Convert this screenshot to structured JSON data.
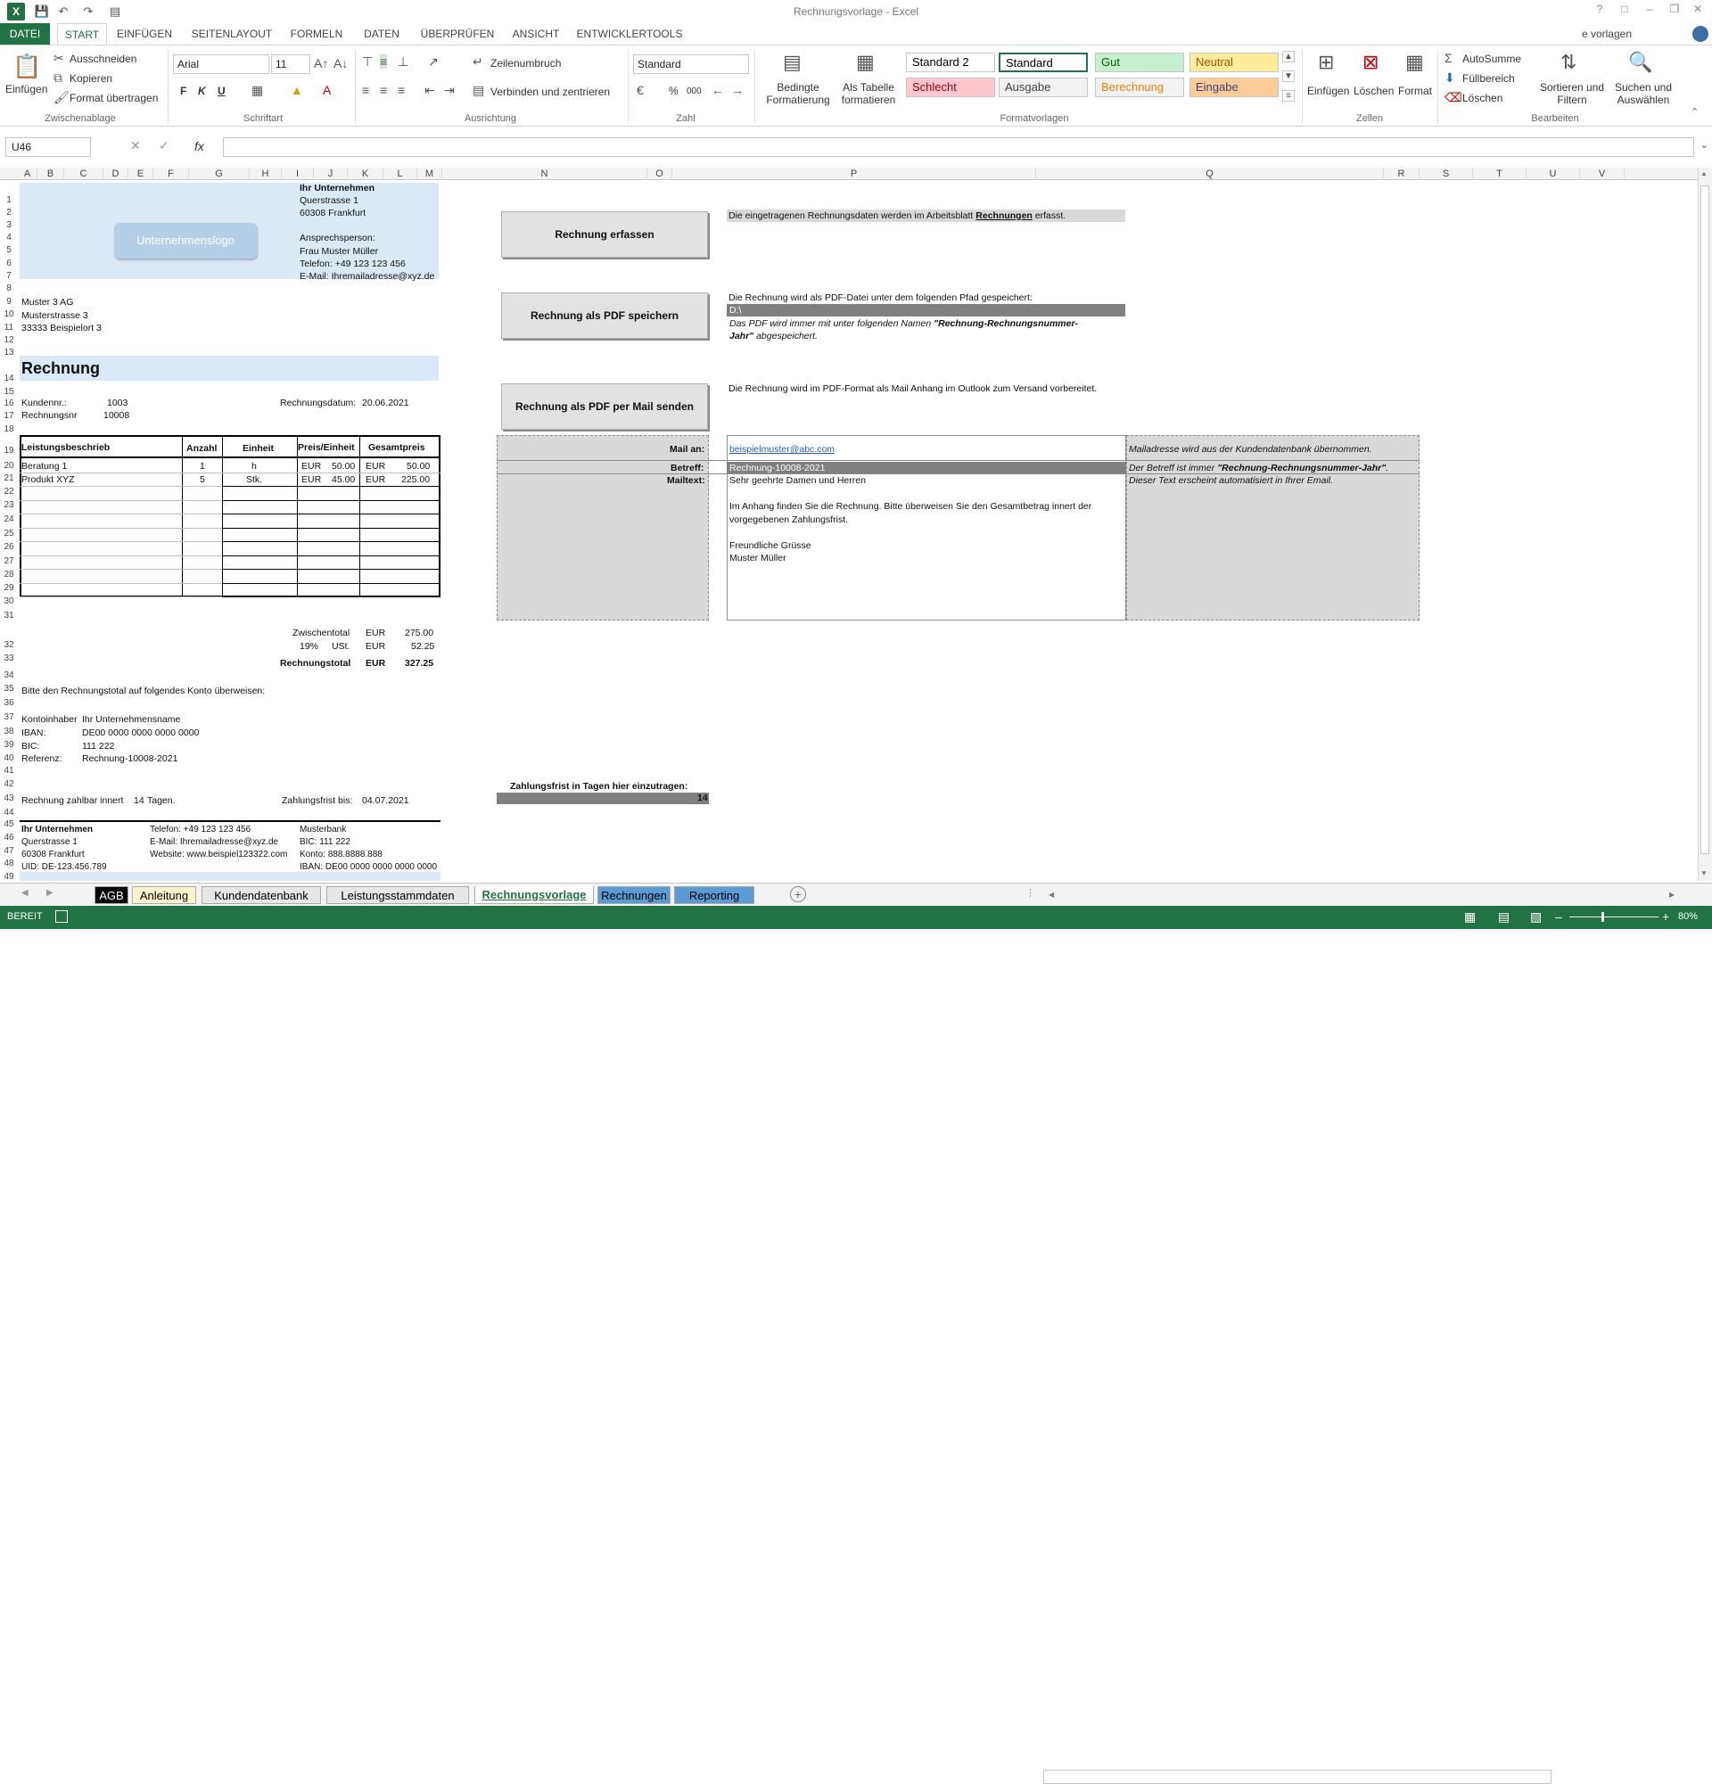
{
  "window": {
    "title": "Rechnungsvorlage - Excel",
    "app_logo": "X"
  },
  "ribbon_tabs": [
    "DATEI",
    "START",
    "EINFÜGEN",
    "SEITENLAYOUT",
    "FORMELN",
    "DATEN",
    "ÜBERPRÜFEN",
    "ANSICHT",
    "ENTWICKLERTOOLS"
  ],
  "user": "e vorlagen",
  "ribbon": {
    "clipboard": {
      "label": "Zwischenablage",
      "paste": "Einfügen",
      "cut": "Ausschneiden",
      "copy": "Kopieren",
      "format_painter": "Format übertragen"
    },
    "font": {
      "label": "Schriftart",
      "name": "Arial",
      "size": "11",
      "bold": "F",
      "italic": "K",
      "underline": "U"
    },
    "alignment": {
      "label": "Ausrichtung",
      "wrap": "Zeilenumbruch",
      "merge": "Verbinden und zentrieren"
    },
    "number": {
      "label": "Zahl",
      "format": "Standard",
      "percent": "%",
      "thousands": "000"
    },
    "styles": {
      "label": "Formatvorlagen",
      "cond_fmt": "Bedingte Formatierung",
      "as_table": "Als Tabelle formatieren",
      "cells": [
        {
          "name": "Standard 2",
          "bg": "#ffffff",
          "fg": "#000000"
        },
        {
          "name": "Standard",
          "bg": "#ffffff",
          "fg": "#000000"
        },
        {
          "name": "Gut",
          "bg": "#c6efce",
          "fg": "#006100"
        },
        {
          "name": "Neutral",
          "bg": "#ffeb9c",
          "fg": "#9c5700"
        },
        {
          "name": "Schlecht",
          "bg": "#ffc7ce",
          "fg": "#9c0006"
        },
        {
          "name": "Ausgabe",
          "bg": "#f2f2f2",
          "fg": "#3f3f3f"
        },
        {
          "name": "Berechnung",
          "bg": "#f2f2f2",
          "fg": "#fa7d00"
        },
        {
          "name": "Eingabe",
          "bg": "#ffcc99",
          "fg": "#3f3f76"
        }
      ]
    },
    "cells_grp": {
      "label": "Zellen",
      "insert": "Einfügen",
      "delete": "Löschen",
      "format": "Format"
    },
    "editing": {
      "label": "Bearbeiten",
      "autosum": "AutoSumme",
      "fill": "Füllbereich",
      "clear": "Löschen",
      "sort": "Sortieren und Filtern",
      "find": "Suchen und Auswählen"
    }
  },
  "formula_bar": {
    "name_box": "U46",
    "fx": "fx",
    "content": ""
  },
  "columns": [
    "A",
    "B",
    "C",
    "D",
    "E",
    "F",
    "G",
    "H",
    "I",
    "J",
    "K",
    "L",
    "M",
    "N",
    "O",
    "P",
    "Q",
    "R",
    "S",
    "T",
    "U",
    "V"
  ],
  "invoice": {
    "logo_text": "Unternehmenslogo",
    "company": [
      "Ihr Unternehmen",
      "Querstrasse 1",
      "60308 Frankfurt",
      "",
      "Ansprechsperson:",
      "Frau Muster Müller",
      "Telefon: +49 123 123 456",
      "E-Mail: Ihremailadresse@xyz.de"
    ],
    "recipient": [
      "Muster 3 AG",
      "Musterstrasse 3",
      "33333  Beispielort 3"
    ],
    "title": "Rechnung",
    "customer_no_label": "Kundennr.:",
    "customer_no": "1003",
    "invoice_no_label": "Rechnungsnr",
    "invoice_no": "10008",
    "date_label": "Rechnungsdatum:",
    "date": "20.06.2021",
    "table_headers": [
      "Leistungsbeschrieb",
      "Anzahl",
      "Einheit",
      "Preis/Einheit",
      "Gesamtpreis"
    ],
    "rows": [
      {
        "desc": "Beratung 1",
        "qty": "1",
        "unit": "h",
        "cur1": "EUR",
        "price": "50.00",
        "cur2": "EUR",
        "total": "50.00"
      },
      {
        "desc": "Produkt XYZ",
        "qty": "5",
        "unit": "Stk.",
        "cur1": "EUR",
        "price": "45.00",
        "cur2": "EUR",
        "total": "225.00"
      }
    ],
    "subtotal_label": "Zwischentotal",
    "subtotal_cur": "EUR",
    "subtotal": "275.00",
    "vat_rate": "19%",
    "vat_label": "USt.",
    "vat_cur": "EUR",
    "vat": "52.25",
    "total_label": "Rechnungstotal",
    "total_cur": "EUR",
    "total": "327.25",
    "pay_text": "Bitte den Rechnungstotal auf folgendes Konto überweisen:",
    "holder_label": "Kontoinhaber",
    "holder": "Ihr Unternehmensname",
    "iban_label": "IBAN:",
    "iban": "DE00 0000 0000 0000 0000",
    "bic_label": "BIC:",
    "bic": "111 222",
    "ref_label": "Referenz:",
    "ref": "Rechnung-10008-2021",
    "due_text": "Rechnung zahlbar innert",
    "due_days": "14",
    "due_unit": "Tagen.",
    "due_date_label": "Zahlungsfrist bis:",
    "due_date": "04.07.2021",
    "footer_col1": [
      "Ihr Unternehmen",
      "Querstrasse 1",
      "60308 Frankfurt",
      "UID: DE-123.456.789"
    ],
    "footer_col2": [
      "Telefon: +49 123 123 456",
      "E-Mail: Ihremailadresse@xyz.de",
      "Website: www.beispiel123322.com"
    ],
    "footer_col3": [
      "Musterbank",
      "BIC: 111 222",
      "Konto: 888.8888.888",
      "IBAN: DE00 0000 0000 0000 0000"
    ]
  },
  "actions": {
    "btn_record": "Rechnung erfassen",
    "btn_record_info": [
      "Die eingetragenen Rechnungsdaten werden im Arbeitsblatt ",
      "Rechnungen",
      " erfasst."
    ],
    "btn_pdf": "Rechnung als PDF speichern",
    "btn_pdf_info": "Die Rechnung wird als PDF-Datei unter dem folgenden Pfad gespeichert:",
    "pdf_path": "D:\\",
    "pdf_note1": "Das PDF wird immer mit unter folgenden Namen ",
    "pdf_note_bold": "\"Rechnung-Rechnungsnummer-",
    "pdf_note2_bold": "Jahr\"",
    "pdf_note2": " abgespeichert.",
    "btn_mail": "Rechnung als PDF per Mail senden",
    "btn_mail_info": "Die Rechnung wird im PDF-Format als Mail Anhang im Outlook zum Versand vorbereitet."
  },
  "mail": {
    "to_label": "Mail an:",
    "to": "beispielmuster@abc.com",
    "to_note": "Mailadresse wird aus der Kundendatenbank übernommen.",
    "subject_label": "Betreff:",
    "subject": "Rechnung-10008-2021",
    "subject_note1": "Der Betreff ist immer ",
    "subject_note_bold": "\"Rechnung-Rechnungsnummer-Jahr\"",
    "subject_note2": ".",
    "body_label": "Mailtext:",
    "body": [
      "Sehr geehrte Damen und Herren",
      "",
      "Im Anhang finden Sie die Rechnung. Bitte überweisen Sie den Gesamtbetrag innert der",
      "vorgegebenen Zahlungsfrist.",
      "",
      "Freundliche Grüsse",
      "Muster Müller"
    ],
    "body_note": "Dieser Text erscheint automatisiert in Ihrer Email."
  },
  "payment_term": {
    "label": "Zahlungsfrist in Tagen hier einzutragen:",
    "value": "14"
  },
  "sheets": [
    {
      "name": "AGB",
      "bg": "#000000",
      "fg": "#ffffff"
    },
    {
      "name": "Anleitung",
      "bg": "#fff2cc",
      "fg": "#000000"
    },
    {
      "name": "Kundendatenbank",
      "bg": "#e7e6e6",
      "fg": "#000000"
    },
    {
      "name": "Leistungsstammdaten",
      "bg": "#e7e6e6",
      "fg": "#000000"
    },
    {
      "name": "Rechnungsvorlage",
      "bg": "#ffffff",
      "fg": "#217346"
    },
    {
      "name": "Rechnungen",
      "bg": "#5b9bd5",
      "fg": "#000000"
    },
    {
      "name": "Reporting",
      "bg": "#5b9bd5",
      "fg": "#000000"
    }
  ],
  "status": {
    "mode": "BEREIT",
    "zoom": "80%"
  }
}
